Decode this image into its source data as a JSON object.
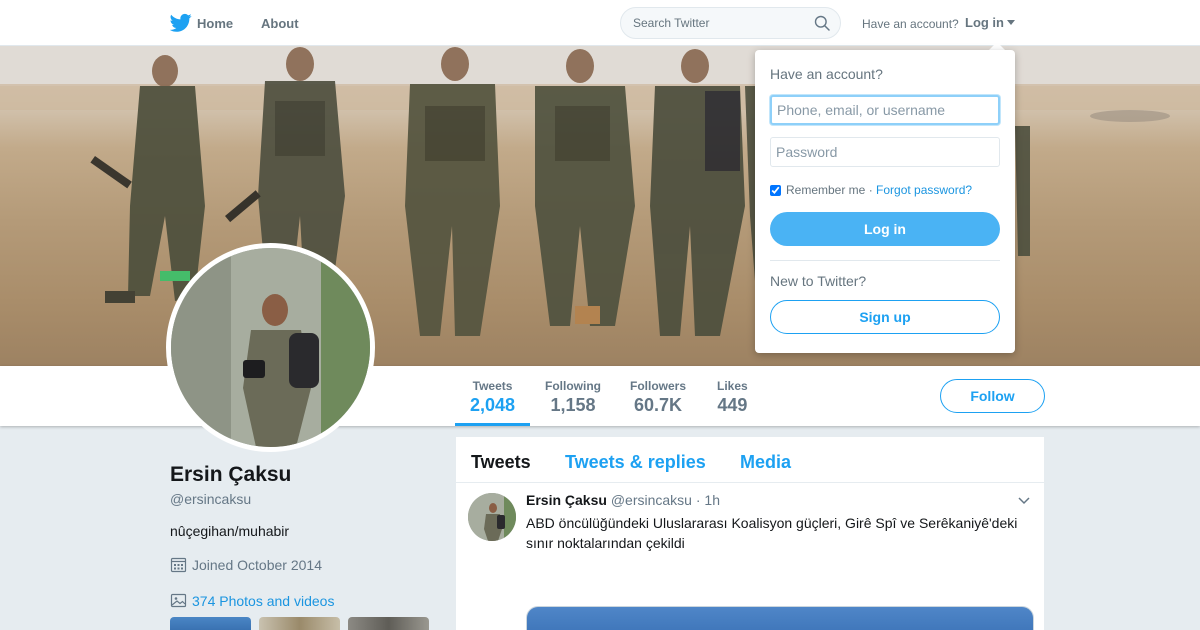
{
  "nav": {
    "home": "Home",
    "about": "About",
    "search_placeholder": "Search Twitter",
    "have_account": "Have an account?",
    "login": "Log in",
    "logo_icon": "twitter-bird-icon",
    "search_icon": "search-icon"
  },
  "colors": {
    "accent": "#1da1f2",
    "link": "#1b95e0",
    "login_button": "#4ab3f4",
    "background": "#e6ecf0"
  },
  "profile": {
    "name": "Ersin Çaksu",
    "handle": "@ersincaksu",
    "bio": "nûçegihan/muhabir",
    "joined": "Joined October 2014",
    "photos": "374 Photos and videos"
  },
  "stats": [
    {
      "label": "Tweets",
      "value": "2,048",
      "active": true
    },
    {
      "label": "Following",
      "value": "1,158"
    },
    {
      "label": "Followers",
      "value": "60.7K"
    },
    {
      "label": "Likes",
      "value": "449"
    }
  ],
  "follow_label": "Follow",
  "tabs": [
    "Tweets",
    "Tweets & replies",
    "Media"
  ],
  "tweet": {
    "name": "Ersin Çaksu",
    "handle": "@ersincaksu",
    "dot": "·",
    "time": "1h",
    "text": "ABD öncülüğündeki Uluslararası Koalisyon güçleri, Girê Spî ve Serêkaniyê'deki sınır noktalarından çekildi"
  },
  "login_dropdown": {
    "title": "Have an account?",
    "username_placeholder": "Phone, email, or username",
    "password_placeholder": "Password",
    "remember": "Remember me",
    "separator": " · ",
    "forgot": "Forgot password?",
    "login_button": "Log in",
    "new_to": "New to Twitter?",
    "signup_button": "Sign up"
  }
}
